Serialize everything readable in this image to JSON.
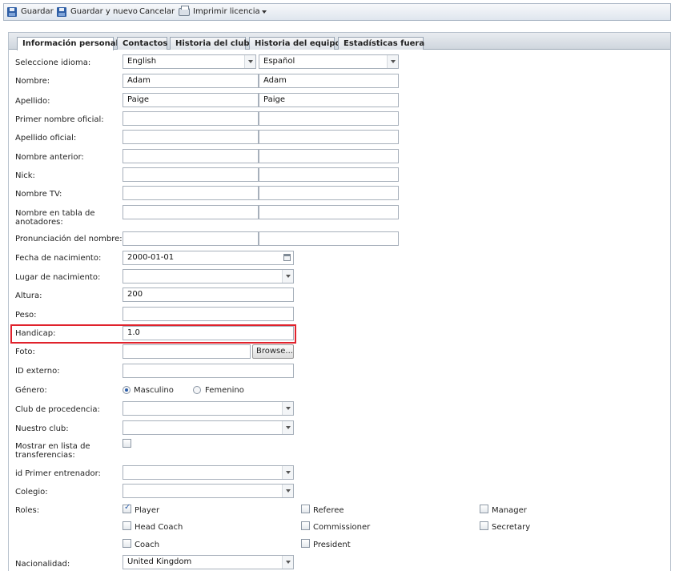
{
  "toolbar": {
    "save_label": "Guardar",
    "save_new_label": "Guardar y nuevo",
    "cancel_label": "Cancelar",
    "print_label": "Imprimir licencia"
  },
  "tabs": [
    {
      "label": "Información personal",
      "active": true
    },
    {
      "label": "Contactos"
    },
    {
      "label": "Historia del club"
    },
    {
      "label": "Historia del equipo"
    },
    {
      "label": "Estadísticas fuera"
    }
  ],
  "form": {
    "language": {
      "label": "Seleccione idioma:",
      "value1": "English",
      "value2": "Español"
    },
    "nombre": {
      "label": "Nombre:",
      "value1": "Adam",
      "value2": "Adam"
    },
    "apellido": {
      "label": "Apellido:",
      "value1": "Paige",
      "value2": "Paige"
    },
    "primer_nombre_oficial": {
      "label": "Primer nombre oficial:",
      "value1": "",
      "value2": ""
    },
    "apellido_oficial": {
      "label": "Apellido oficial:",
      "value1": "",
      "value2": ""
    },
    "nombre_anterior": {
      "label": "Nombre anterior:",
      "value1": "",
      "value2": ""
    },
    "nick": {
      "label": "Nick:",
      "value1": "",
      "value2": ""
    },
    "nombre_tv": {
      "label": "Nombre TV:",
      "value1": "",
      "value2": ""
    },
    "nombre_tabla": {
      "label": "Nombre en tabla de anotadores:",
      "value1": "",
      "value2": ""
    },
    "pronunciacion": {
      "label": "Pronunciación del nombre:",
      "value1": "",
      "value2": ""
    },
    "fecha_nacimiento": {
      "label": "Fecha de nacimiento:",
      "value": "2000-01-01"
    },
    "lugar_nacimiento": {
      "label": "Lugar de nacimiento:",
      "value": ""
    },
    "altura": {
      "label": "Altura:",
      "value": "200"
    },
    "peso": {
      "label": "Peso:",
      "value": ""
    },
    "handicap": {
      "label": "Handicap:",
      "value": "1.0"
    },
    "foto": {
      "label": "Foto:",
      "value": "",
      "browse_label": "Browse..."
    },
    "id_externo": {
      "label": "ID externo:",
      "value": ""
    },
    "genero": {
      "label": "Género:",
      "option1": "Masculino",
      "option2": "Femenino",
      "selected": "Masculino"
    },
    "club_procedencia": {
      "label": "Club de procedencia:",
      "value": ""
    },
    "nuestro_club": {
      "label": "Nuestro club:",
      "value": ""
    },
    "transferencias": {
      "label": "Mostrar en lista de transferencias:",
      "checked": false
    },
    "primer_entrenador": {
      "label": "id Primer entrenador:",
      "value": ""
    },
    "colegio": {
      "label": "Colegio:",
      "value": ""
    },
    "roles": {
      "label": "Roles:",
      "items": [
        {
          "label": "Player",
          "checked": true
        },
        {
          "label": "Referee",
          "checked": false
        },
        {
          "label": "Manager",
          "checked": false
        },
        {
          "label": "Head Coach",
          "checked": false
        },
        {
          "label": "Commissioner",
          "checked": false
        },
        {
          "label": "Secretary",
          "checked": false
        },
        {
          "label": "Coach",
          "checked": false
        },
        {
          "label": "President",
          "checked": false
        }
      ]
    },
    "nacionalidad": {
      "label": "Nacionalidad:",
      "value": "United Kingdom"
    }
  }
}
